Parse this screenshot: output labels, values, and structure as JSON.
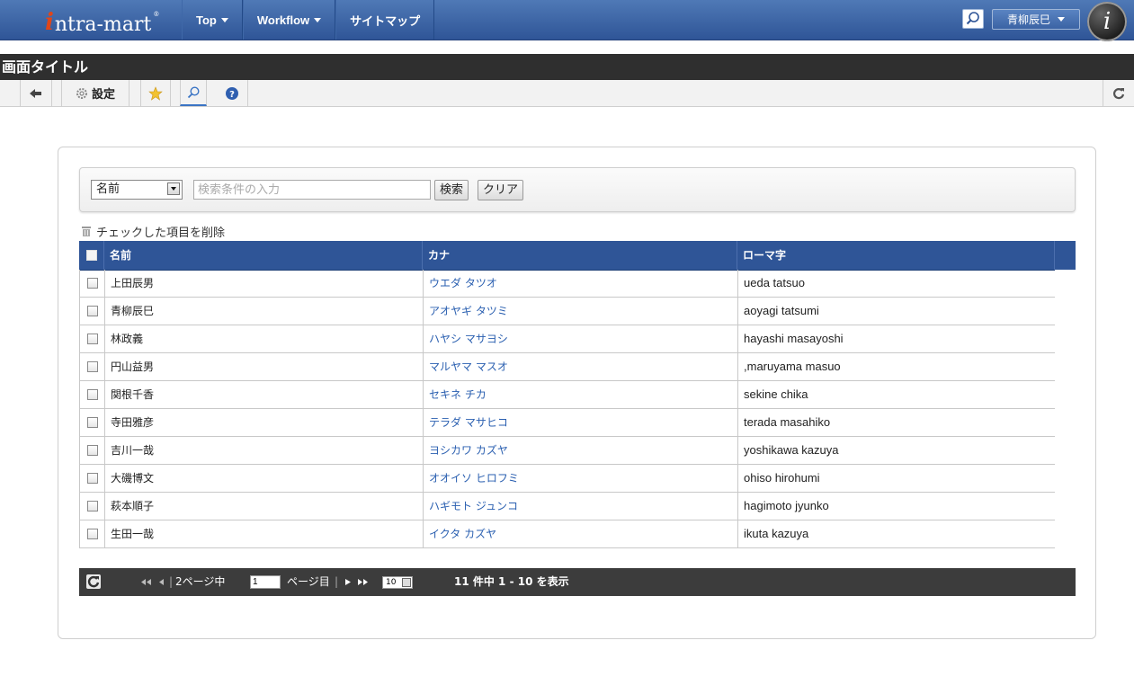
{
  "header": {
    "logo_prefix": "i",
    "logo_text": "ntra-mart",
    "logo_mark": "®",
    "nav": [
      {
        "label": "Top",
        "has_menu": true
      },
      {
        "label": "Workflow",
        "has_menu": true
      },
      {
        "label": "サイトマップ",
        "has_menu": false
      }
    ],
    "user_name": "青柳辰巳",
    "brand_mark": "i"
  },
  "page": {
    "title": "画面タイトル"
  },
  "toolbar": {
    "back_icon": "arrow-left-icon",
    "settings_label": "設定",
    "favorite_icon": "star-icon",
    "search_icon": "search-icon",
    "help_icon": "help-icon",
    "reload_icon": "reload-icon"
  },
  "search": {
    "field_selected": "名前",
    "placeholder": "検索条件の入力",
    "search_button": "検索",
    "clear_button": "クリア"
  },
  "delete_label": "チェックした項目を削除",
  "table": {
    "columns": [
      "名前",
      "カナ",
      "ローマ字"
    ],
    "rows": [
      {
        "name": "上田辰男",
        "kana": "ウエダ タツオ",
        "romaji": "ueda tatsuo"
      },
      {
        "name": "青柳辰巳",
        "kana": "アオヤギ タツミ",
        "romaji": "aoyagi tatsumi"
      },
      {
        "name": "林政義",
        "kana": "ハヤシ マサヨシ",
        "romaji": "hayashi masayoshi"
      },
      {
        "name": "円山益男",
        "kana": "マルヤマ マスオ",
        "romaji": ",maruyama masuo"
      },
      {
        "name": "関根千香",
        "kana": "セキネ チカ",
        "romaji": "sekine chika"
      },
      {
        "name": "寺田雅彦",
        "kana": "テラダ マサヒコ",
        "romaji": "terada masahiko"
      },
      {
        "name": "吉川一哉",
        "kana": "ヨシカワ カズヤ",
        "romaji": "yoshikawa kazuya"
      },
      {
        "name": "大磯博文",
        "kana": "オオイソ ヒロフミ",
        "romaji": "ohiso hirohumi"
      },
      {
        "name": "萩本順子",
        "kana": "ハギモト ジュンコ",
        "romaji": "hagimoto jyunko"
      },
      {
        "name": "生田一哉",
        "kana": "イクタ カズヤ",
        "romaji": "ikuta kazuya"
      }
    ]
  },
  "pager": {
    "total_pages_label": "2ページ中",
    "current_page": "1",
    "page_suffix": "ページ目",
    "rows_per_page": "10",
    "summary": "11 件中 1 - 10 を表示"
  }
}
